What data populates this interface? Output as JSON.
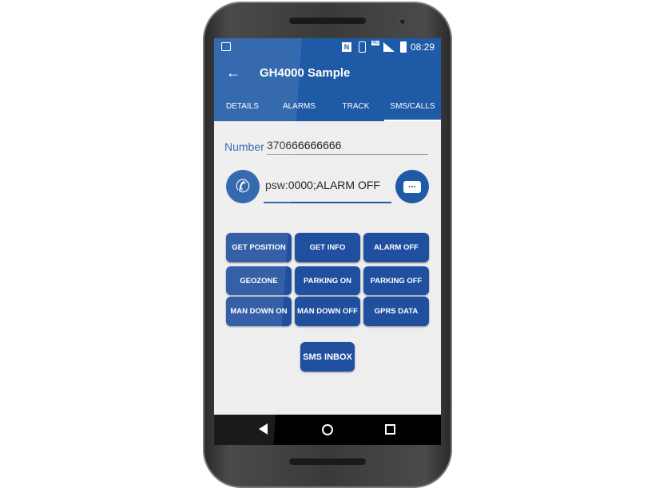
{
  "status_bar": {
    "time": "08:29",
    "network": "4G",
    "icons": [
      "image-icon",
      "nfc-icon",
      "vibrate-icon",
      "signal-icon",
      "battery-icon"
    ]
  },
  "toolbar": {
    "title": "GH4000 Sample",
    "back_icon": "arrow-left-icon"
  },
  "tabs": [
    {
      "label": "DETAILS"
    },
    {
      "label": "ALARMS"
    },
    {
      "label": "TRACK"
    },
    {
      "label": "SMS/CALLS"
    }
  ],
  "form": {
    "number_label": "Number",
    "number_value": "370666666666",
    "message_value": "psw:0000;ALARM OFF"
  },
  "commands": [
    {
      "label": "GET POSITION"
    },
    {
      "label": "GET INFO"
    },
    {
      "label": "ALARM OFF"
    },
    {
      "label": "GEOZONE"
    },
    {
      "label": "PARKING ON"
    },
    {
      "label": "PARKING OFF"
    },
    {
      "label": "MAN DOWN ON"
    },
    {
      "label": "MAN DOWN OFF"
    },
    {
      "label": "GPRS DATA"
    }
  ],
  "sms_inbox_label": "SMS INBOX",
  "colors": {
    "primary": "#1f5aa6",
    "button": "#1f4f9e",
    "background": "#eeeeee"
  }
}
